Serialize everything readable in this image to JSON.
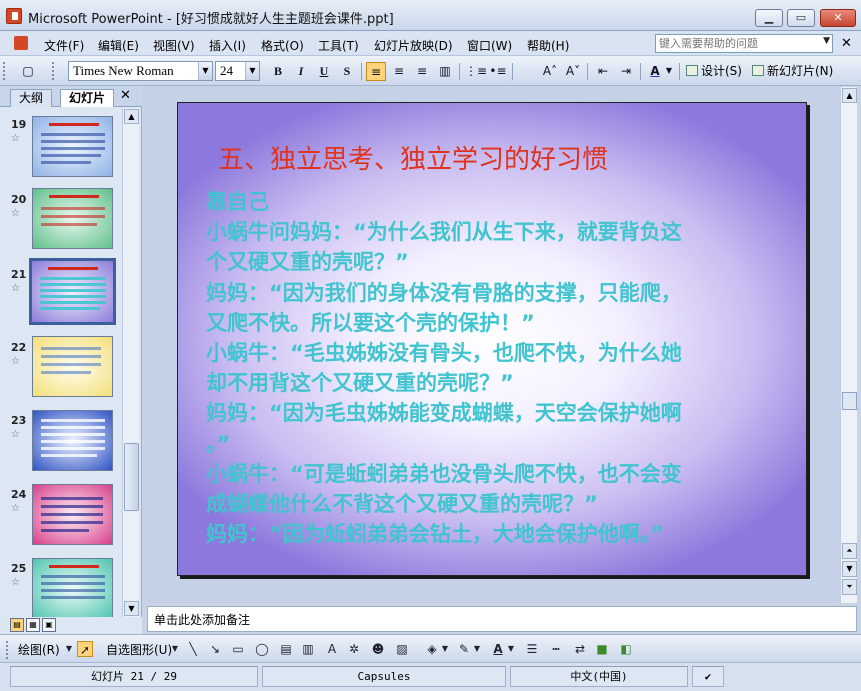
{
  "window": {
    "title": "Microsoft PowerPoint - [好习惯成就好人生主题班会课件.ppt]",
    "minimize_glyph": "▁",
    "maximize_glyph": "▭",
    "close_glyph": "✕"
  },
  "menubar": {
    "items": [
      "文件(F)",
      "编辑(E)",
      "视图(V)",
      "插入(I)",
      "格式(O)",
      "工具(T)",
      "幻灯片放映(D)",
      "窗口(W)",
      "帮助(H)"
    ],
    "help_placeholder": "键入需要帮助的问题",
    "close_doc_glyph": "✕"
  },
  "toolbar": {
    "font_name": "Times New Roman",
    "font_size": "24",
    "bold": "B",
    "italic": "I",
    "underline": "U",
    "shadow": "S",
    "design_label": "设计(S)",
    "new_slide_label": "新幻灯片(N)"
  },
  "left_pane": {
    "tabs": [
      "大纲",
      "幻灯片"
    ],
    "close_glyph": "✕",
    "thumbnails": [
      {
        "number": "19",
        "selected": false
      },
      {
        "number": "20",
        "selected": false
      },
      {
        "number": "21",
        "selected": true
      },
      {
        "number": "22",
        "selected": false
      },
      {
        "number": "23",
        "selected": false
      },
      {
        "number": "24",
        "selected": false
      },
      {
        "number": "25",
        "selected": false
      }
    ],
    "star_glyph": "☆"
  },
  "slide": {
    "title": "五、独立思考、独立学习的好习惯",
    "body_lines": [
      "靠自己",
      "小蜗牛问妈妈：“为什么我们从生下来，就要背负这",
      "个又硬又重的壳呢？”",
      "妈妈：“因为我们的身体没有骨胳的支撑，只能爬，",
      "又爬不快。所以要这个壳的保护！”",
      "小蜗牛：“毛虫姊姊没有骨头，也爬不快，为什么她",
      "却不用背这个又硬又重的壳呢？”",
      "妈妈：“因为毛虫姊姊能变成蝴蝶，天空会保护她啊",
      "。”",
      "小蜗牛：“可是蚯蚓弟弟也没骨头爬不快，也不会变",
      "成蝴蝶他什么不背这个又硬又重的壳呢？”",
      "妈妈：“因为蚯蚓弟弟会钻土，大地会保护他啊。”"
    ],
    "title_color": "#e0321d",
    "body_color": "#41c4cf"
  },
  "notes": {
    "placeholder": "单击此处添加备注"
  },
  "drawbar": {
    "draw_label": "绘图(R)",
    "autoshapes_label": "自选图形(U)"
  },
  "statusbar": {
    "slide_info": "幻灯片 21 / 29",
    "design_name": "Capsules",
    "language": "中文(中国)"
  }
}
